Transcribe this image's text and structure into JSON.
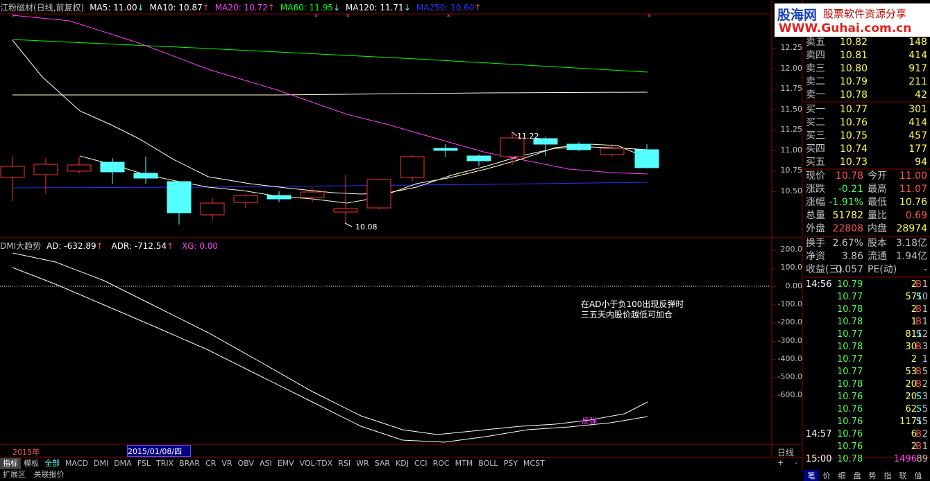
{
  "header": {
    "title": "江粉磁材(日线,前复权)",
    "ma5": "MA5: 11.00",
    "ma10": "MA10: 10.87",
    "ma20": "MA20: 10.72",
    "ma60": "MA60: 11.95",
    "ma120": "MA120: 11.71",
    "ma250": "MA250: 10.60"
  },
  "colors": {
    "up": "#ff3232",
    "down": "#54ffff",
    "ma20": "#ff00ff",
    "ma60": "#00ff00",
    "ma250": "#2020ff",
    "grid": "#8b0000"
  },
  "logo": {
    "line1": "股海网",
    "line2": "股票软件资源分享",
    "line3": "WWW.Guhai.com.cn"
  },
  "price_axis": [
    "12.25",
    "12.00",
    "11.75",
    "11.50",
    "11.25",
    "11.00",
    "10.75",
    "10.50"
  ],
  "annotations": {
    "high": "11.22",
    "low": "10.08",
    "note1": "在AD小于负100出现反弹时",
    "note2": "三五天内股价越低可加仓",
    "rebound": "反弹"
  },
  "indicator": {
    "name": "DMI大趋势",
    "ad": "AD: -632.89",
    "adr": "ADR: -712.54",
    "xg": "XG: 0.00"
  },
  "ind_axis": [
    "200.0",
    "100.0",
    "0.00",
    "-100.0",
    "-200.0",
    "-300.0",
    "-400.0",
    "-500.0",
    "-600.0"
  ],
  "orderbook": {
    "sell": [
      {
        "label": "卖五",
        "price": "10.82",
        "vol": "148"
      },
      {
        "label": "卖四",
        "price": "10.81",
        "vol": "414"
      },
      {
        "label": "卖三",
        "price": "10.80",
        "vol": "917"
      },
      {
        "label": "卖二",
        "price": "10.79",
        "vol": "211"
      },
      {
        "label": "卖一",
        "price": "10.78",
        "vol": "42"
      }
    ],
    "buy": [
      {
        "label": "买一",
        "price": "10.77",
        "vol": "301"
      },
      {
        "label": "买二",
        "price": "10.76",
        "vol": "414"
      },
      {
        "label": "买三",
        "price": "10.75",
        "vol": "457"
      },
      {
        "label": "买四",
        "price": "10.74",
        "vol": "177"
      },
      {
        "label": "买五",
        "price": "10.73",
        "vol": "94"
      }
    ]
  },
  "quote": [
    {
      "l1": "现价",
      "v1": "10.78",
      "l2": "今开",
      "v2": "11.00"
    },
    {
      "l1": "涨跌",
      "v1": "-0.21",
      "l2": "最高",
      "v2": "11.07"
    },
    {
      "l1": "涨幅",
      "v1": "-1.91%",
      "l2": "最低",
      "v2": "10.76"
    },
    {
      "l1": "总量",
      "v1": "51782",
      "l2": "量比",
      "v2": "0.69"
    },
    {
      "l1": "外盘",
      "v1": "22808",
      "l2": "内盘",
      "v2": "28974"
    }
  ],
  "quote2": [
    {
      "l1": "换手",
      "v1": "2.67%",
      "l2": "股本",
      "v2": "3.18亿"
    },
    {
      "l1": "净资",
      "v1": "3.86",
      "l2": "流通",
      "v2": "1.94亿"
    },
    {
      "l1": "收益(三)",
      "v1": "0.057",
      "l2": "PE(动)",
      "v2": "-"
    }
  ],
  "ticks": [
    {
      "t": "14:56",
      "p": "10.79",
      "v": "2",
      "d": "B",
      "n": "1"
    },
    {
      "t": "",
      "p": "10.77",
      "v": "57",
      "d": "S",
      "n": "10"
    },
    {
      "t": "",
      "p": "10.78",
      "v": "2",
      "d": "B",
      "n": "1"
    },
    {
      "t": "",
      "p": "10.78",
      "v": "1",
      "d": "B",
      "n": "1"
    },
    {
      "t": "",
      "p": "10.77",
      "v": "81",
      "d": "S",
      "n": "12"
    },
    {
      "t": "",
      "p": "10.78",
      "v": "30",
      "d": "B",
      "n": "3"
    },
    {
      "t": "",
      "p": "10.77",
      "v": "2",
      "d": "",
      "n": "1"
    },
    {
      "t": "",
      "p": "10.77",
      "v": "53",
      "d": "B",
      "n": "5"
    },
    {
      "t": "",
      "p": "10.78",
      "v": "20",
      "d": "B",
      "n": "2"
    },
    {
      "t": "",
      "p": "10.76",
      "v": "20",
      "d": "S",
      "n": "3"
    },
    {
      "t": "",
      "p": "10.76",
      "v": "62",
      "d": "S",
      "n": "5"
    },
    {
      "t": "",
      "p": "10.76",
      "v": "117",
      "d": "S",
      "n": "15"
    },
    {
      "t": "14:57",
      "p": "10.76",
      "v": "6",
      "d": "B",
      "n": "2"
    },
    {
      "t": "",
      "p": "10.76",
      "v": "2",
      "d": "B",
      "n": "1"
    },
    {
      "t": "15:00",
      "p": "10.78",
      "v": "1496",
      "d": "",
      "n": "89"
    }
  ],
  "xaxis": {
    "year": "2015年",
    "date": "2015/01/08/四",
    "period": "日线"
  },
  "tabs": [
    "指标",
    "模板",
    "全部",
    "MACD",
    "DMI",
    "DMA",
    "FSL",
    "TRIX",
    "BRAR",
    "CR",
    "VR",
    "OBV",
    "ASI",
    "EMV",
    "VOL-TDX",
    "RSI",
    "WR",
    "SAR",
    "KDJ",
    "CCI",
    "ROC",
    "MTM",
    "BOLL",
    "PSY",
    "MCST"
  ],
  "tab_controls": [
    "+",
    "-"
  ],
  "bottom": [
    "扩展区",
    "关联报价"
  ],
  "right_tabs": [
    "笔",
    "价",
    "细",
    "盘",
    "势",
    "指",
    "联",
    "值"
  ]
}
